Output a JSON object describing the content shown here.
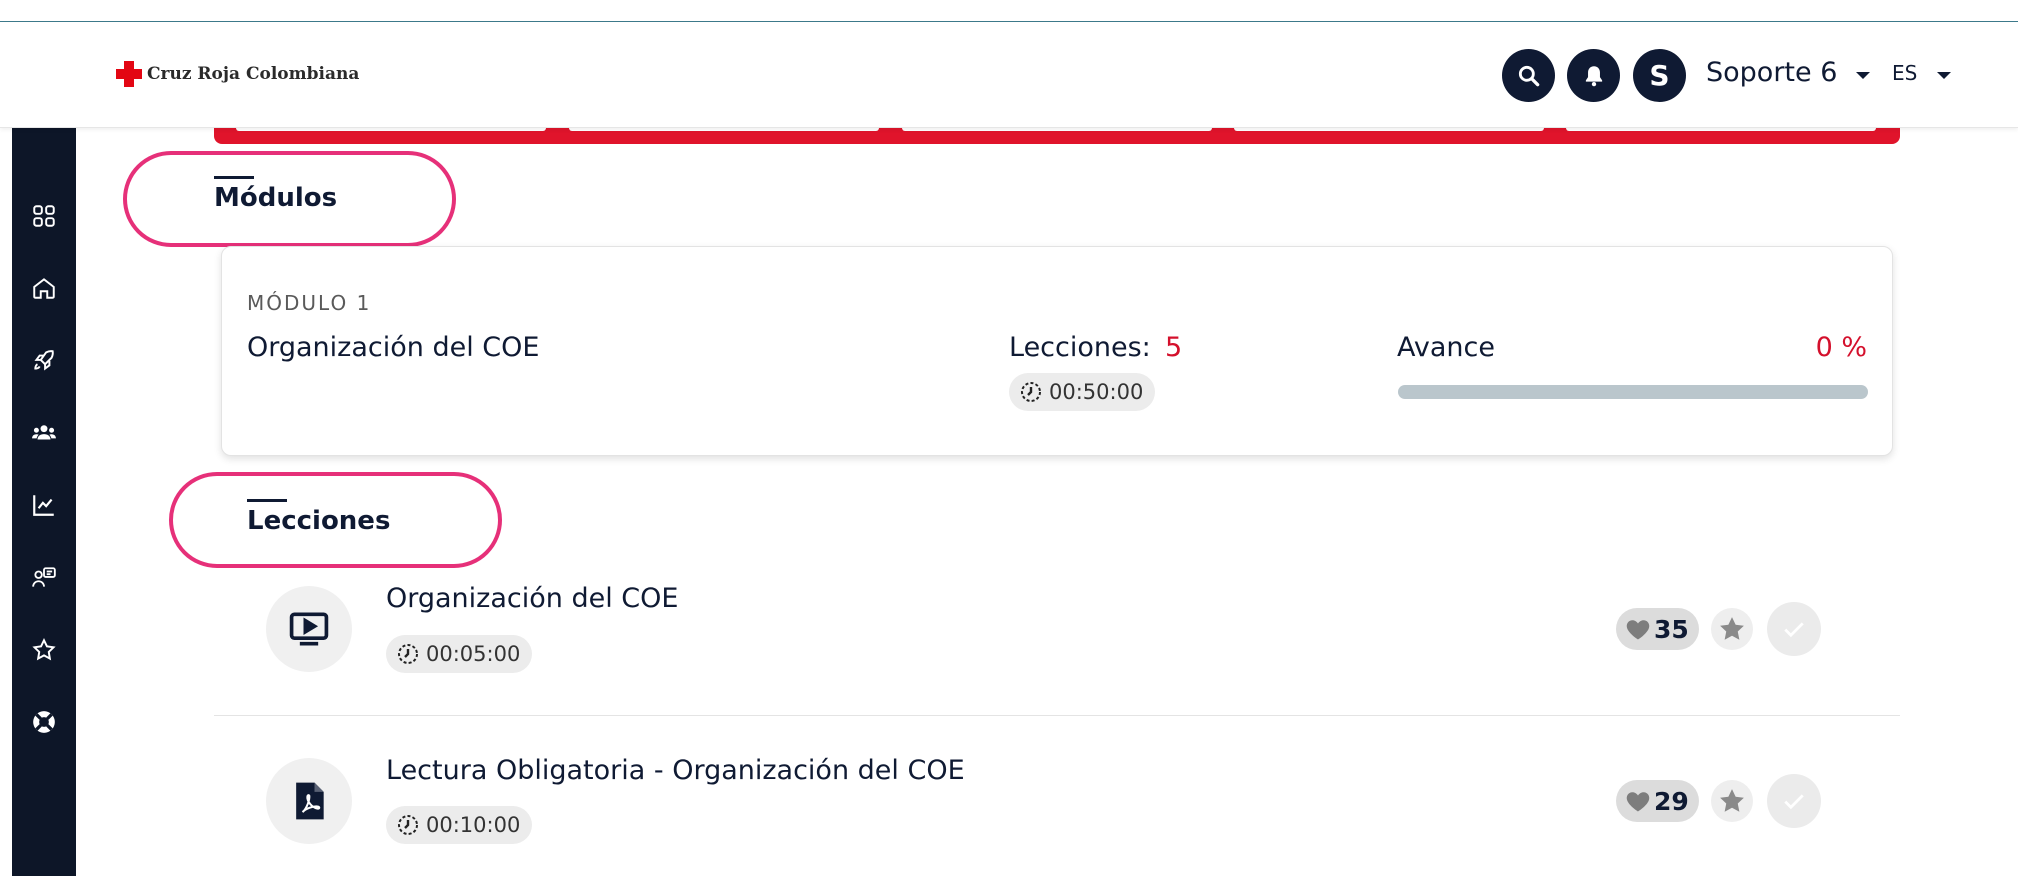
{
  "header": {
    "logo_text": "Cruz Roja Colombiana",
    "avatar_letter": "S",
    "user_name": "Soporte 6",
    "language": "ES"
  },
  "sidebar": {
    "icons": [
      "grid-icon",
      "home-icon",
      "rocket-icon",
      "users-icon",
      "chart-icon",
      "chat-user-icon",
      "star-icon",
      "lifebuoy-icon"
    ]
  },
  "modules_section": {
    "title": "Módulos",
    "card": {
      "label": "MÓDULO 1",
      "name": "Organización del COE",
      "lessons_label": "Lecciones:",
      "lessons_count": "5",
      "duration": "00:50:00",
      "progress_label": "Avance",
      "progress_value": "0 %",
      "progress_fraction": 0
    }
  },
  "lessons_section": {
    "title": "Lecciones",
    "items": [
      {
        "type_icon": "video-icon",
        "title": "Organización del COE",
        "duration": "00:05:00",
        "likes": "35"
      },
      {
        "type_icon": "pdf-icon",
        "title": "Lectura Obligatoria - Organización del COE",
        "duration": "00:10:00",
        "likes": "29"
      }
    ]
  },
  "colors": {
    "accent_red": "#d4102c",
    "navy": "#0f1a33",
    "highlight_pink": "#e63079"
  }
}
